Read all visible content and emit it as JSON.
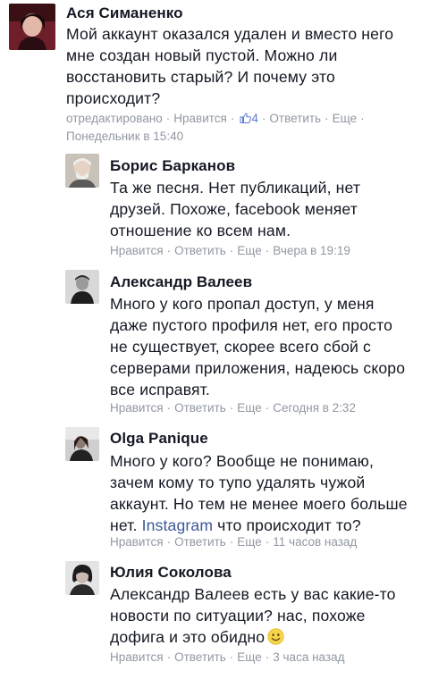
{
  "comments": [
    {
      "author": "Ася Симаненко",
      "lines": [
        "Мой аккаунт оказался удален и вместо него",
        "мне создан новый пустой. Можно ли",
        "восстановить старый? И почему это",
        "происходит?"
      ],
      "edited": "отредактировано",
      "like": "Нравится",
      "likes_count": "4",
      "reply": "Ответить",
      "more": "Еще",
      "time": "Понедельник в 15:40"
    },
    {
      "author": "Борис Барканов",
      "lines": [
        "Та же песня. Нет публикаций, нет",
        "друзей. Похоже, facebook меняет",
        "отношение ко всем нам."
      ],
      "like": "Нравится",
      "reply": "Ответить",
      "more": "Еще",
      "time": "Вчера в 19:19"
    },
    {
      "author": "Александр Валеев",
      "lines": [
        "Много у кого пропал доступ, у меня",
        "даже пустого профиля нет, его просто",
        "не существует, скорее всего сбой с",
        "серверами приложения, надеюсь скоро",
        "все исправят."
      ],
      "like": "Нравится",
      "reply": "Ответить",
      "more": "Еще",
      "time": "Сегодня в 2:32"
    },
    {
      "author": "Olga Panique",
      "lines": [
        "Много у кого? Вообще не понимаю,",
        "зачем кому то тупо удалять чужой",
        "аккаунт. Но тем не менее моего больше"
      ],
      "last_line_link": "Instagram",
      "last_line_rest": " что происходит то?",
      "last_line_prefix": "нет. ",
      "like": "Нравится",
      "reply": "Ответить",
      "more": "Еще",
      "time": "11 часов назад"
    },
    {
      "author": "Юлия Соколова",
      "lines": [
        "Александр Валеев есть у вас какие-то",
        "новости по ситуации? нас, похоже"
      ],
      "last_line": "дофига и это обидно",
      "emoji": "smile-emoji",
      "like": "Нравится",
      "reply": "Ответить",
      "more": "Еще",
      "time": "3 часа назад"
    }
  ],
  "colors": {
    "text": "#141823",
    "meta": "#9197a3",
    "link": "#3b5998",
    "like_count": "#5b7bd5"
  }
}
